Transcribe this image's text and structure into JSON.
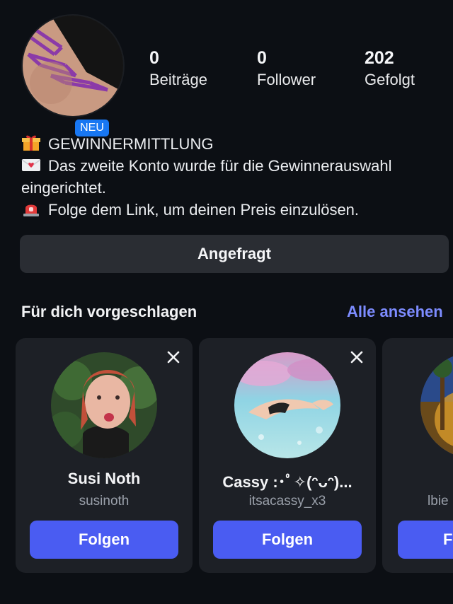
{
  "profile": {
    "badge": "NEU",
    "stats": [
      {
        "value": "0",
        "label": "Beiträge"
      },
      {
        "value": "0",
        "label": "Follower"
      },
      {
        "value": "202",
        "label": "Gefolgt"
      }
    ],
    "bio": {
      "line1": "GEWINNERMITTLUNG",
      "line2": "Das zweite Konto wurde für die Gewinnerauswahl",
      "line3": "eingerichtet.",
      "line4": "Folge dem Link, um deinen Preis einzulösen."
    },
    "requested_label": "Angefragt"
  },
  "suggestions": {
    "title": "Für dich vorgeschlagen",
    "see_all": "Alle ansehen",
    "cards": [
      {
        "name": "Susi Noth",
        "handle": "susinoth",
        "follow": "Folgen"
      },
      {
        "name": "Cassy :･ﾟ✧(ᵔᴗᵔ)...",
        "handle": "itsacassy_x3",
        "follow": "Folgen"
      },
      {
        "name": "",
        "handle": "lbie",
        "follow": "F"
      }
    ]
  },
  "colors": {
    "background": "#0c0f14",
    "card": "#1d2026",
    "follow_button": "#4a5cf2",
    "link": "#7d8cff",
    "badge": "#1877f2"
  }
}
